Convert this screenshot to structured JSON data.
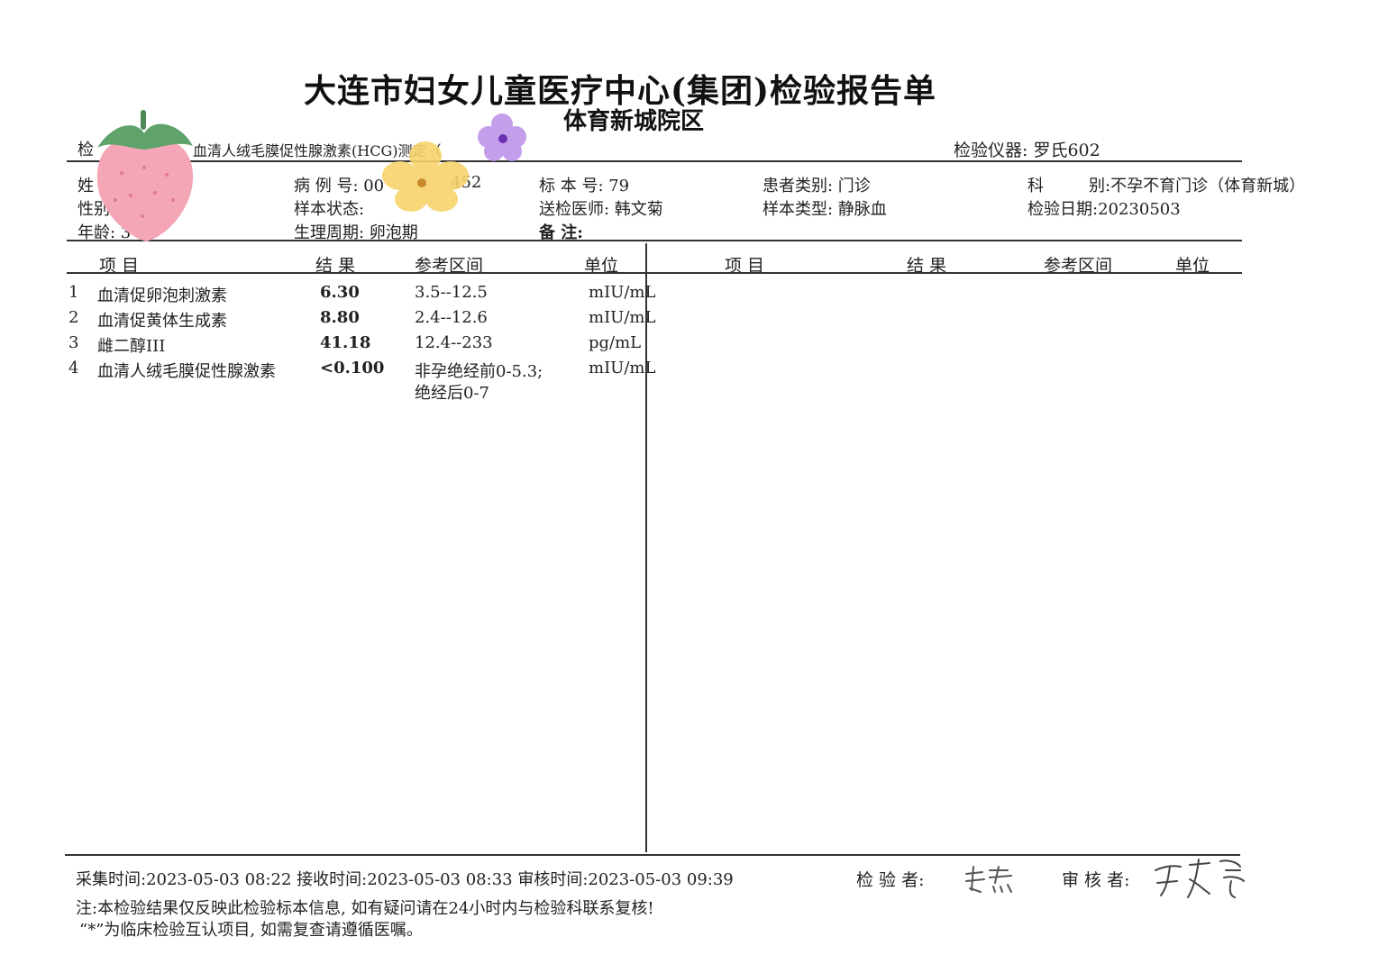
{
  "header": {
    "title": "大连市妇女儿童医疗中心(集团)检验报告单",
    "subtitle": "体育新城院区",
    "test_name_prefix": "检",
    "test_name_text": "血清人绒毛膜促性腺激素(HCG)测定（",
    "instrument": "检验仪器: 罗氏602"
  },
  "patient": {
    "name_label": "姓",
    "gender_label": "性别",
    "age_label": "年龄: 3",
    "case_no": "病 例 号: 00",
    "case_no_tail": "452",
    "sample_status": "样本状态:",
    "cycle": "生理周期: 卵泡期",
    "sample_no": "标 本 号: 79",
    "doctor": "送检医师: 韩文菊",
    "remark": "备    注:",
    "patient_type": "患者类别: 门诊",
    "sample_type": "样本类型: 静脉血",
    "department_label": "科",
    "department": "别:不孕不育门诊（体育新城）",
    "test_date": "检验日期:20230503"
  },
  "table": {
    "headers": {
      "item": "项  目",
      "result": "结 果",
      "range": "参考区间",
      "unit": "单位"
    },
    "rows": [
      {
        "no": "1",
        "item": "血清促卵泡刺激素",
        "result": "6.30",
        "range": "3.5--12.5",
        "unit": "mIU/mL"
      },
      {
        "no": "2",
        "item": "血清促黄体生成素",
        "result": "8.80",
        "range": "2.4--12.6",
        "unit": "mIU/mL"
      },
      {
        "no": "3",
        "item": "雌二醇III",
        "result": "41.18",
        "range": "12.4--233",
        "unit": "pg/mL"
      },
      {
        "no": "4",
        "item": "血清人绒毛膜促性腺激素",
        "result": "<0.100",
        "range": "非孕绝经前0-5.3;",
        "range2": "绝经后0-7",
        "unit": "mIU/mL"
      }
    ]
  },
  "footer": {
    "times": "采集时间:2023-05-03 08:22  接收时间:2023-05-03 08:33 审核时间:2023-05-03 09:39",
    "tester_label": "检 验 者:",
    "tester_signature": "黄杰",
    "reviewer_label": "审 核 者:",
    "reviewer_signature": "于志宇",
    "note1": "注:本检验结果仅反映此检验标本信息, 如有疑问请在24小时内与检验科联系复核!",
    "note2": "“*”为临床检验互认项目, 如需复查请遵循医嘱。"
  },
  "stickers": {
    "strawberry_color": "#f4a6b6",
    "leaf_color": "#5fa36a",
    "flower_yellow": "#f7d36b",
    "flower_purple": "#b98ee8"
  }
}
